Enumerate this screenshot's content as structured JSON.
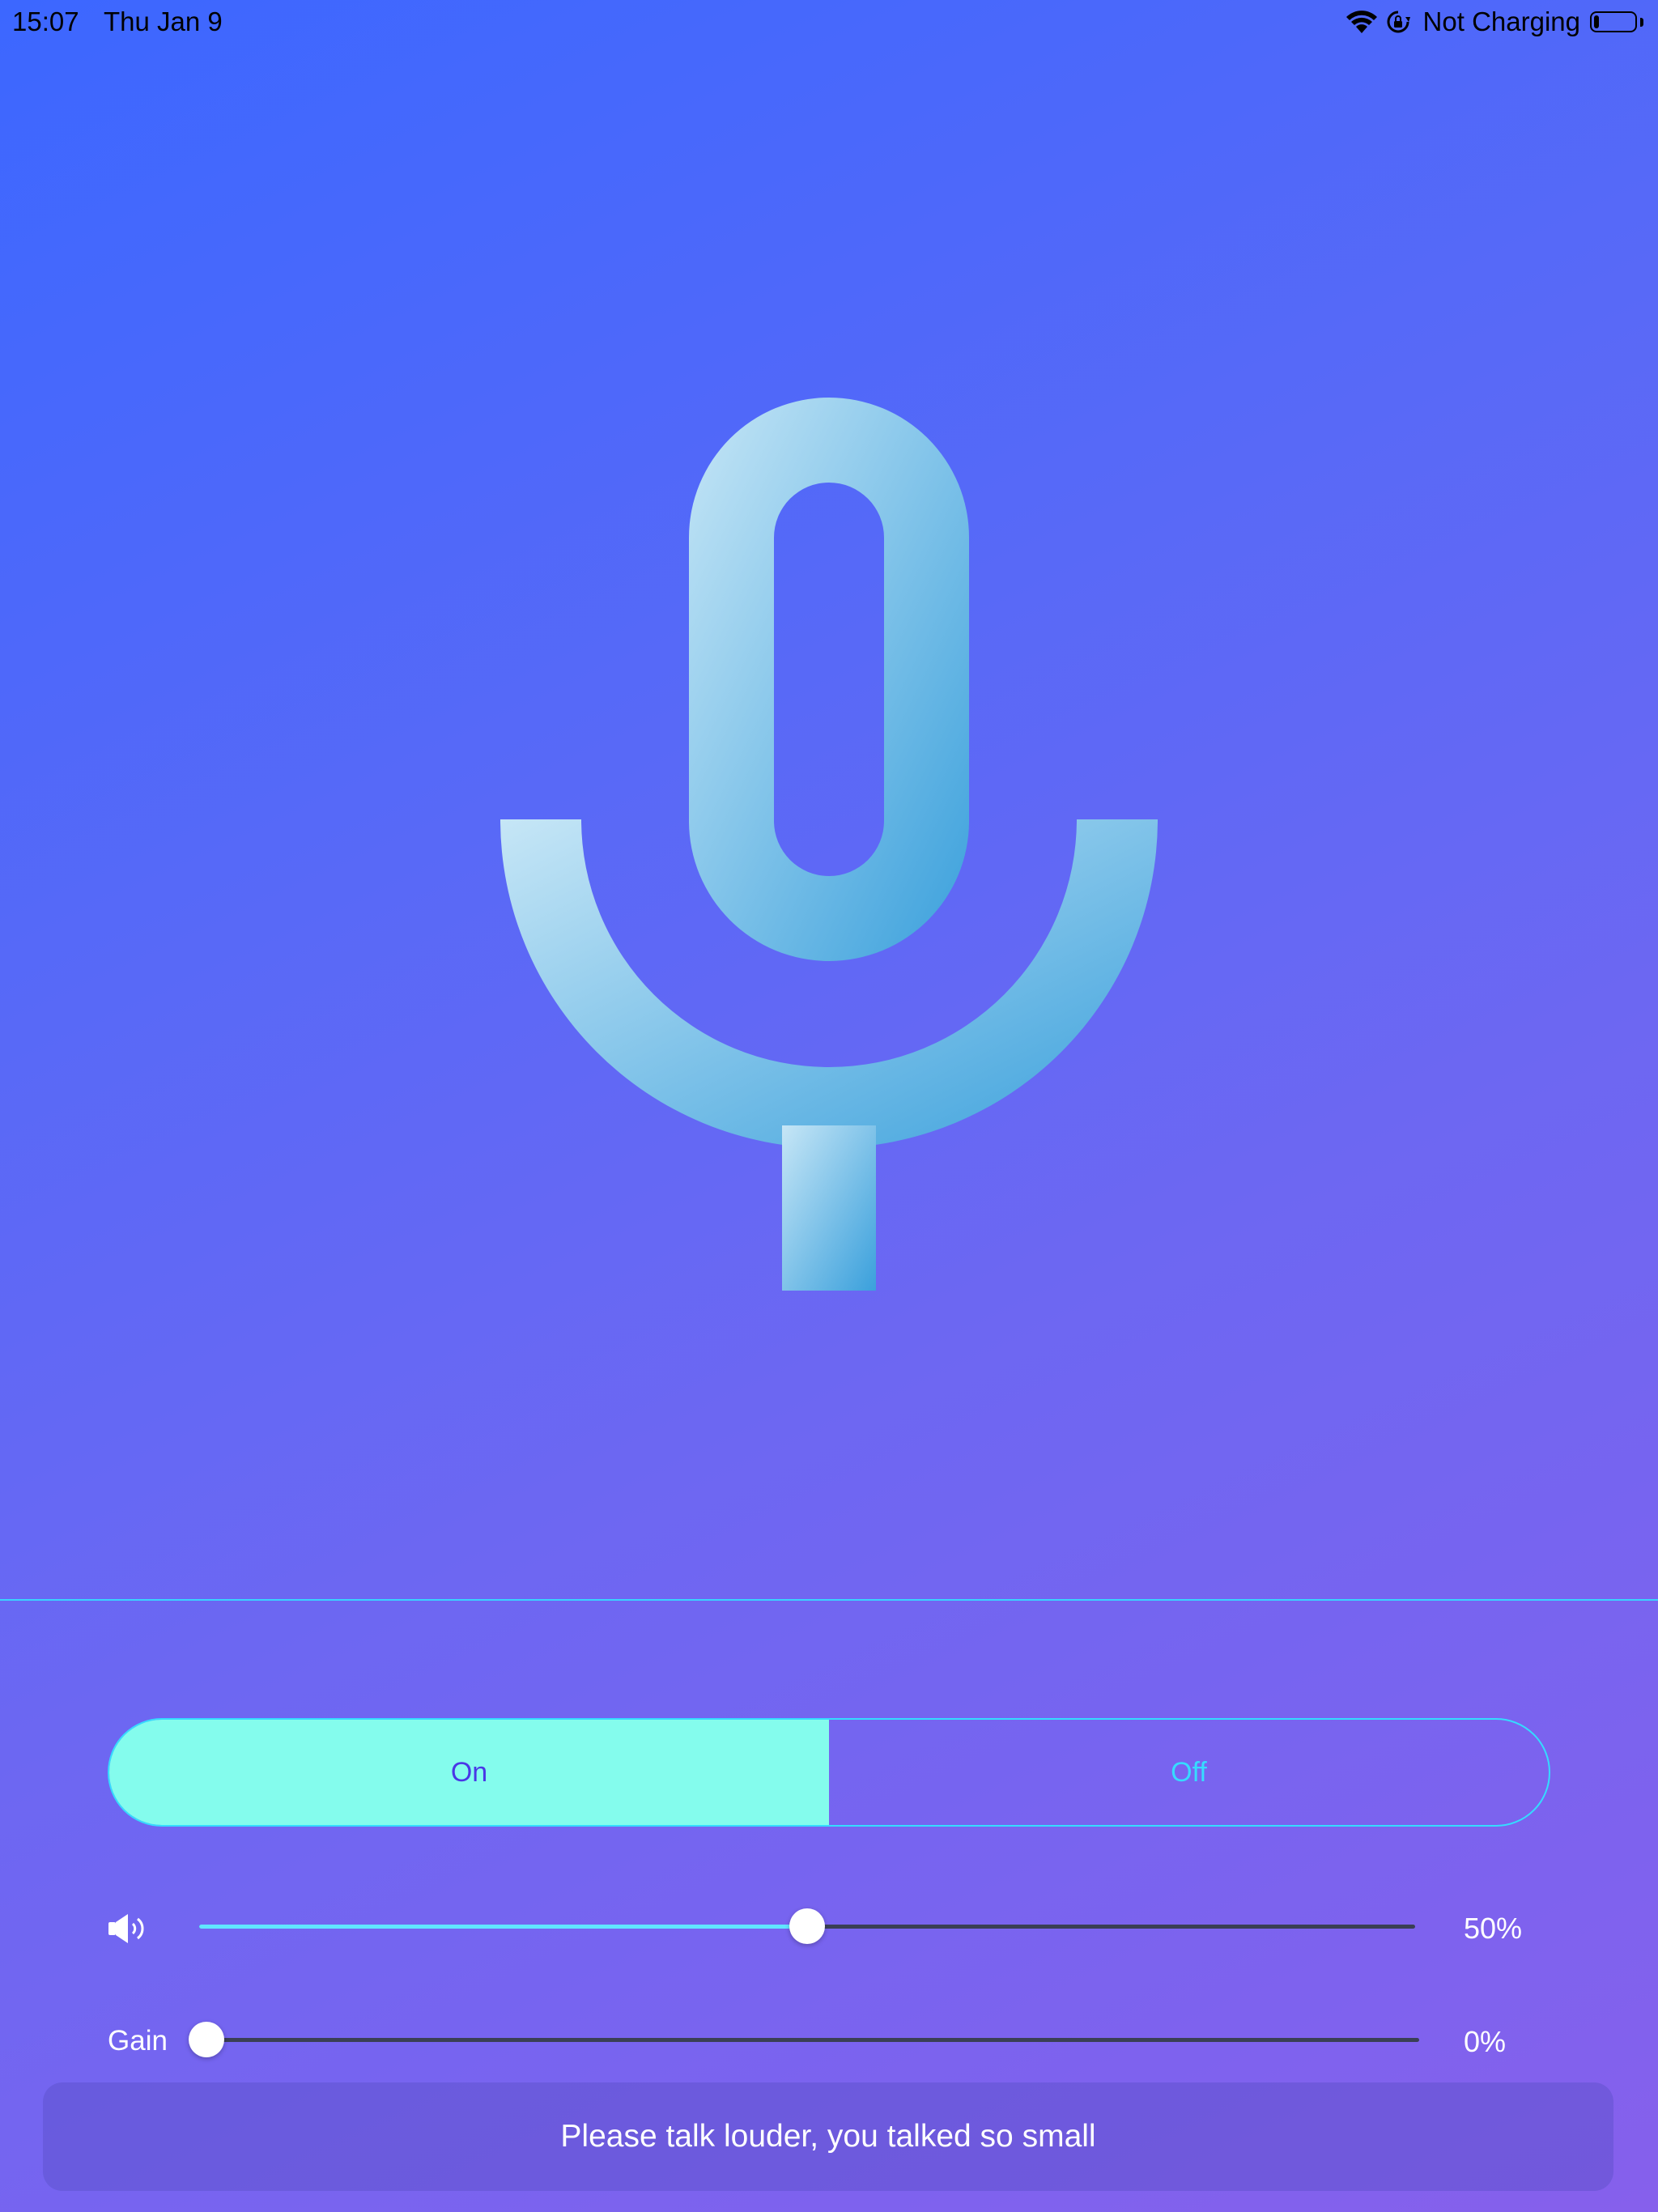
{
  "status_bar": {
    "time": "15:07",
    "date": "Thu Jan 9",
    "charging": "Not Charging",
    "battery_level": 0.12
  },
  "mic": {
    "icon": "microphone-icon",
    "gradient_start": "#c6e6f6",
    "gradient_end": "#3aa0dc"
  },
  "mode_toggle": {
    "on_label": "On",
    "off_label": "Off",
    "selected": "On",
    "accent": "#84fced"
  },
  "volume": {
    "icon": "speaker-icon",
    "value": 0.5,
    "value_label": "50%"
  },
  "gain": {
    "label": "Gain",
    "value": 0,
    "value_label": "0%"
  },
  "toast": {
    "message": "Please talk louder, you talked so small"
  }
}
